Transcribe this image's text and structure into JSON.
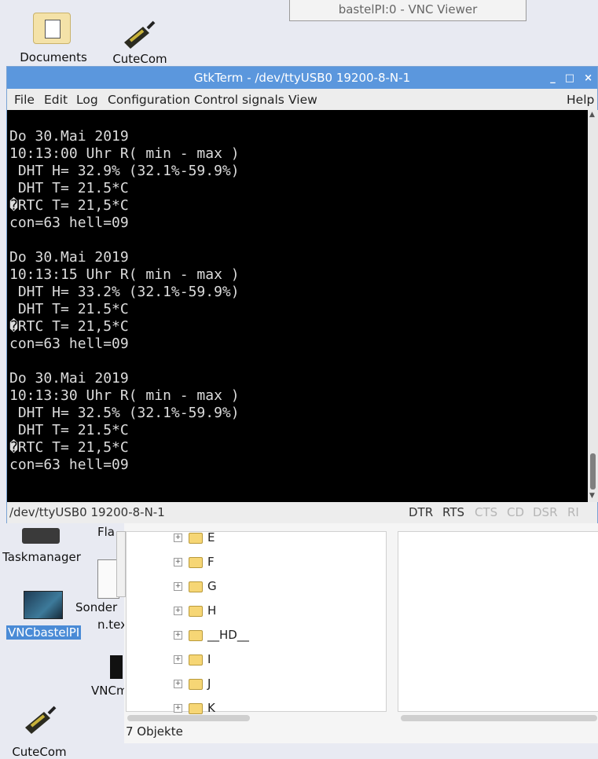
{
  "desktop": {
    "vnc_title": "bastelPI:0 - VNC Viewer",
    "icons": {
      "documents": "Documents",
      "cutecom_top": "CuteCom",
      "taskmanager": "Taskmanager",
      "vncbastelpi": "VNCbastelPI",
      "sonder_line1": "Sonder",
      "sonder_line2": "n.tex",
      "vncm": "VNCm",
      "cutecom_bottom": "CuteCom",
      "partial_fla": "Fla"
    }
  },
  "gtkterm": {
    "title": "GtkTerm - /dev/ttyUSB0  19200-8-N-1",
    "window_buttons": {
      "minimize": "_",
      "maximize": "□",
      "close": "×"
    },
    "menu": {
      "file": "File",
      "edit": "Edit",
      "log": "Log",
      "configuration": "Configuration",
      "control_signals": "Control signals",
      "view": "View",
      "help": "Help"
    },
    "terminal_lines": [
      "Do 30.Mai 2019",
      "10:13:00 Uhr R( min - max )",
      " DHT H= 32.9% (32.1%-59.9%)",
      " DHT T= 21.5*C",
      "�RTC T= 21,5*C",
      "con=63 hell=09",
      "",
      "Do 30.Mai 2019",
      "10:13:15 Uhr R( min - max )",
      " DHT H= 33.2% (32.1%-59.9%)",
      " DHT T= 21.5*C",
      "�RTC T= 21,5*C",
      "con=63 hell=09",
      "",
      "Do 30.Mai 2019",
      "10:13:30 Uhr R( min - max )",
      " DHT H= 32.5% (32.1%-59.9%)",
      " DHT T= 21.5*C",
      "�RTC T= 21,5*C",
      "con=63 hell=09"
    ],
    "status": {
      "port_info": "/dev/ttyUSB0  19200-8-N-1",
      "dtr": "DTR",
      "rts": "RTS",
      "cts": "CTS",
      "cd": "CD",
      "dsr": "DSR",
      "ri": "RI"
    },
    "colors": {
      "titlebar": "#5b97dd",
      "signal_active": "#333333",
      "signal_inactive": "#b5b5b5"
    }
  },
  "file_manager": {
    "tree": [
      "E",
      "F",
      "G",
      "H",
      "__HD__",
      "I",
      "J",
      "K"
    ],
    "status": "7 Objekte"
  }
}
